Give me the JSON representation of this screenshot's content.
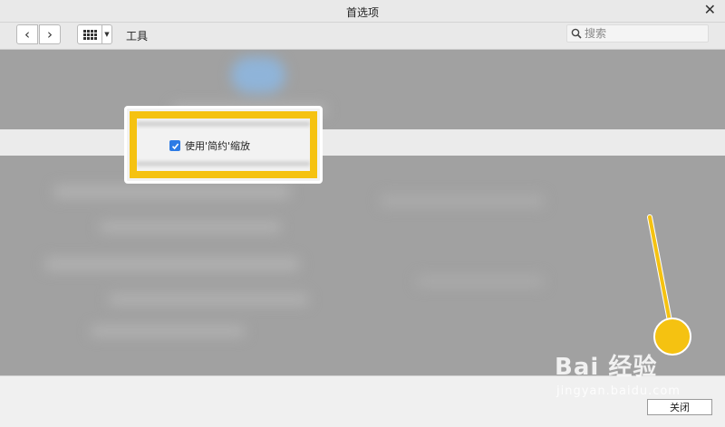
{
  "window": {
    "title": "首选项",
    "close_icon": "close-icon"
  },
  "toolbar": {
    "back_icon": "chevron-left-icon",
    "forward_icon": "chevron-right-icon",
    "grid_icon": "grid-icon",
    "dropdown_icon": "caret-down-icon",
    "section_label": "工具",
    "search_placeholder": "搜索"
  },
  "settings": {
    "highlighted_option": {
      "label": "使用'简约'缩放",
      "checked": true
    }
  },
  "footer": {
    "close_button_label": "关闭"
  },
  "watermark": {
    "brand": "Bai 经验",
    "url": "jingyan.baidu.com"
  },
  "colors": {
    "annotation": "#f5c211",
    "checkbox": "#2d7be5",
    "dim_overlay": "#a1a1a1"
  }
}
